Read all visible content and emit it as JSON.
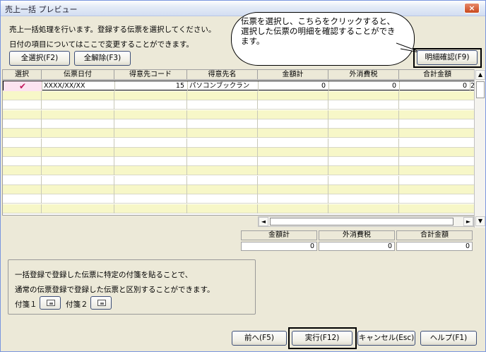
{
  "window": {
    "title": "売上一括 プレビュー",
    "close_glyph": "×"
  },
  "instructions": {
    "line1": "売上一括処理を行います。登録する伝票を選択してください。",
    "line2": "日付の項目についてはここで変更することができます。"
  },
  "buttons": {
    "select_all": "全選択(F2)",
    "deselect_all": "全解除(F3)",
    "detail_confirm": "明細確認(F9)",
    "prev": "前へ(F5)",
    "execute": "実行(F12)",
    "cancel": "キャンセル(Esc)",
    "help": "ヘルプ(F1)"
  },
  "callout": {
    "text": "伝票を選択し、こちらをクリックすると、選択した伝票の明細を確認することができます。"
  },
  "grid": {
    "columns": [
      "選択",
      "伝票日付",
      "得意先コード",
      "得意先名",
      "金額計",
      "外消費税",
      "合計金額"
    ],
    "rows": [
      {
        "selected": true,
        "check_glyph": "✔",
        "date": "XXXX/XX/XX",
        "customer_code": "15",
        "customer_name": "パソコンブックラン",
        "amount": "0",
        "tax": "0",
        "total": "0",
        "overflow": "2"
      }
    ],
    "empty_rows": 13
  },
  "scroll": {
    "left_glyph": "◄",
    "right_glyph": "►",
    "up_glyph": "▲",
    "down_glyph": "▼"
  },
  "totals": {
    "amount_label": "金額計",
    "amount_value": "0",
    "tax_label": "外消費税",
    "tax_value": "0",
    "total_label": "合計金額",
    "total_value": "0"
  },
  "tags": {
    "note_line1": "一括登録で登録した伝票に特定の付箋を貼ることで、",
    "note_line2": "通常の伝票登録で登録した伝票と区別することができます。",
    "tag1_label": "付箋１",
    "tag2_label": "付箋２"
  },
  "colors": {
    "stripe": "#f7f7c8",
    "check": "#c2185b",
    "selected_row": "#fce4f0"
  }
}
